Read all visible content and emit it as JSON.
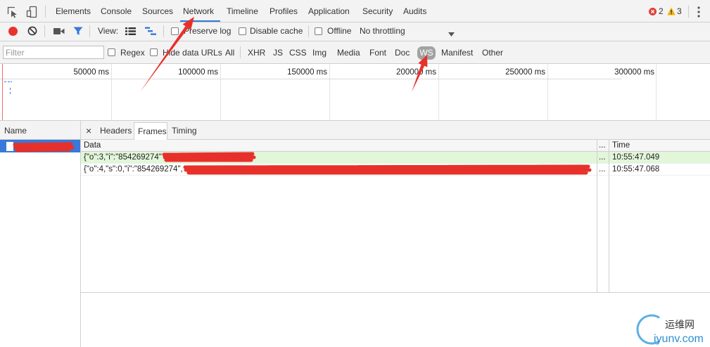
{
  "toolbar": {
    "tabs": [
      {
        "label": "Elements",
        "active": false
      },
      {
        "label": "Console",
        "active": false
      },
      {
        "label": "Sources",
        "active": false
      },
      {
        "label": "Network",
        "active": true
      },
      {
        "label": "Timeline",
        "active": false
      },
      {
        "label": "Profiles",
        "active": false
      },
      {
        "label": "Application",
        "active": false
      },
      {
        "label": "Security",
        "active": false
      },
      {
        "label": "Audits",
        "active": false
      }
    ],
    "error_count": "2",
    "warning_count": "3"
  },
  "network_toolbar": {
    "recording": true,
    "view_label": "View:",
    "preserve_log": {
      "label": "Preserve log",
      "checked": false
    },
    "disable_cache": {
      "label": "Disable cache",
      "checked": false
    },
    "offline": {
      "label": "Offline",
      "checked": false
    },
    "throttling": "No throttling"
  },
  "filter_bar": {
    "placeholder": "Filter",
    "regex": {
      "label": "Regex",
      "checked": false
    },
    "hide_data_urls": {
      "label": "Hide data URLs",
      "checked": false
    },
    "types": [
      {
        "label": "All",
        "active": false
      },
      {
        "label": "XHR",
        "active": false
      },
      {
        "label": "JS",
        "active": false
      },
      {
        "label": "CSS",
        "active": false
      },
      {
        "label": "Img",
        "active": false
      },
      {
        "label": "Media",
        "active": false
      },
      {
        "label": "Font",
        "active": false
      },
      {
        "label": "Doc",
        "active": false
      },
      {
        "label": "WS",
        "active": true
      },
      {
        "label": "Manifest",
        "active": false
      },
      {
        "label": "Other",
        "active": false
      }
    ]
  },
  "overview": {
    "ticks": [
      "50000 ms",
      "100000 ms",
      "150000 ms",
      "200000 ms",
      "250000 ms",
      "300000 ms"
    ]
  },
  "requests": {
    "header": "Name"
  },
  "detail": {
    "close_label": "×",
    "tabs": [
      {
        "label": "Headers",
        "active": false
      },
      {
        "label": "Frames",
        "active": true
      },
      {
        "label": "Timing",
        "active": false
      }
    ]
  },
  "frames": {
    "columns": {
      "data": "Data",
      "more": "...",
      "time": "Time"
    },
    "rows": [
      {
        "data": "{\"o\":3,\"i\":\"854269274\"",
        "more": "...",
        "time": "10:55:47.049",
        "outgoing": true
      },
      {
        "data": "{\"o\":4,\"s\":0,\"i\":\"854269274\",",
        "more": "...",
        "time": "10:55:47.068",
        "outgoing": false
      }
    ]
  },
  "watermark": {
    "name": "运维网",
    "site": "iyunv.com"
  },
  "icons": [
    "inspect-element-icon",
    "device-toolbar-icon",
    "error-icon",
    "warning-icon",
    "more-menu-icon",
    "record-icon",
    "clear-icon",
    "screenshot-camera-icon",
    "filter-funnel-icon",
    "list-view-icon",
    "waterfall-view-icon",
    "dropdown-arrow-icon",
    "file-icon",
    "close-icon"
  ],
  "colors": {
    "accent": "#3879d9",
    "record": "#e8322e",
    "error": "#e0403a",
    "warning": "#f4b400",
    "outgoing_frame_bg": "#e2f6da",
    "annotation": "#e8302a",
    "watermark_blue": "#2a8fd6"
  }
}
